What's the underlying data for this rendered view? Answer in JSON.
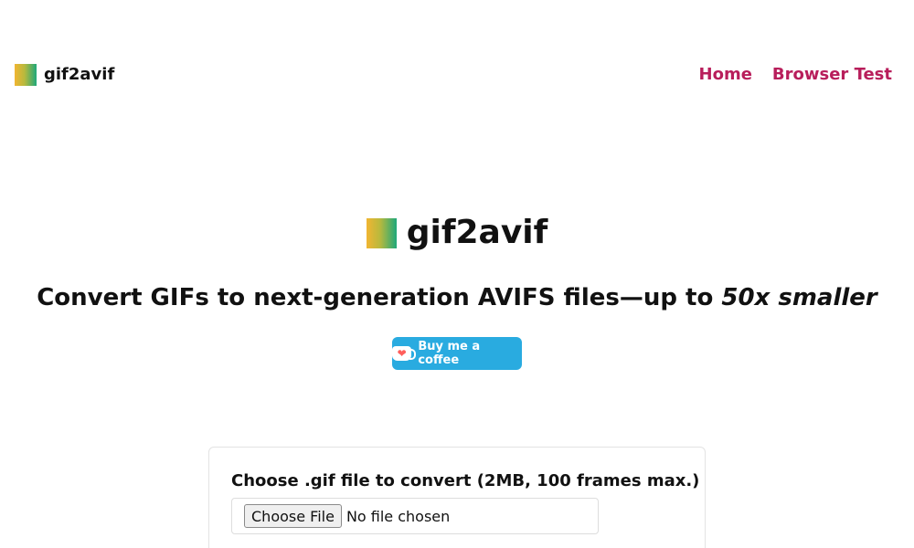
{
  "header": {
    "brand_name": "gif2avif",
    "nav": [
      {
        "label": "Home"
      },
      {
        "label": "Browser Test"
      }
    ]
  },
  "hero": {
    "title": "gif2avif",
    "tagline_main": "Convert GIFs to next-generation AVIFS files—up to ",
    "tagline_emphasis": "50x smaller"
  },
  "coffee_button": {
    "label": "Buy me a coffee"
  },
  "upload": {
    "label": "Choose .gif file to convert (2MB, 100 frames max.)",
    "button_label": "Choose File",
    "status": "No file chosen"
  },
  "colors": {
    "link": "#b81e5b",
    "coffee": "#29abe0"
  }
}
